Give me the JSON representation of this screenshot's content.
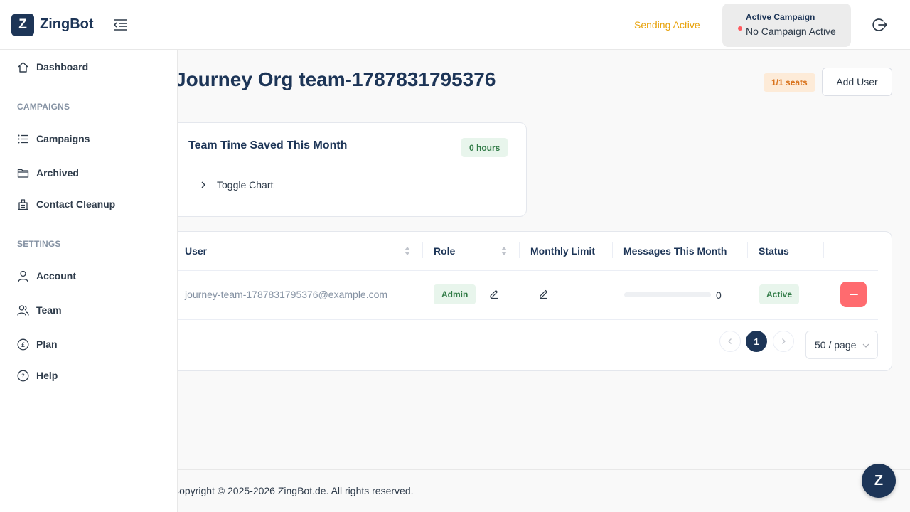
{
  "brand": {
    "mark": "Z",
    "name": "ZingBot"
  },
  "header": {
    "sending_status": "Sending Active",
    "campaign_label": "Active Campaign",
    "campaign_value": "No Campaign Active"
  },
  "sidebar": {
    "dashboard": "Dashboard",
    "campaigns_section": "CAMPAIGNS",
    "campaigns": "Campaigns",
    "archived": "Archived",
    "contact_cleanup": "Contact Cleanup",
    "settings_section": "SETTINGS",
    "account": "Account",
    "team": "Team",
    "plan": "Plan",
    "help": "Help"
  },
  "page": {
    "title": "Journey Org team-1787831795376",
    "seats": "1/1 seats",
    "add_user": "Add User"
  },
  "time_card": {
    "title": "Team Time Saved This Month",
    "hours": "0 hours",
    "toggle": "Toggle Chart"
  },
  "table": {
    "headers": {
      "user": "User",
      "role": "Role",
      "monthly_limit": "Monthly Limit",
      "messages": "Messages This Month",
      "status": "Status"
    },
    "rows": [
      {
        "email": "journey-team-1787831795376@example.com",
        "role": "Admin",
        "messages_count": "0",
        "messages_progress": 0,
        "status": "Active"
      }
    ]
  },
  "pagination": {
    "current": "1",
    "page_size": "50 / page"
  },
  "footer": {
    "copyright": "Copyright © 2025-2026 ZingBot.de. All rights reserved."
  },
  "fab": {
    "label": "Z"
  },
  "colors": {
    "brand": "#1d3557",
    "sending": "#e8a20a",
    "danger": "#ff6b6f",
    "success_bg": "#e8f5ec",
    "success_text": "#2f7a45",
    "warning_bg": "#fdebd8",
    "warning_text": "#d9731c"
  },
  "icons": {
    "menu_toggle": "menu-fold-icon",
    "logout": "logout-icon",
    "dashboard": "home-icon",
    "campaigns": "list-icon",
    "archived": "folder-icon",
    "contact_cleanup": "building-icon",
    "account": "user-icon",
    "team": "team-icon",
    "plan": "pound-icon",
    "help": "question-icon"
  }
}
